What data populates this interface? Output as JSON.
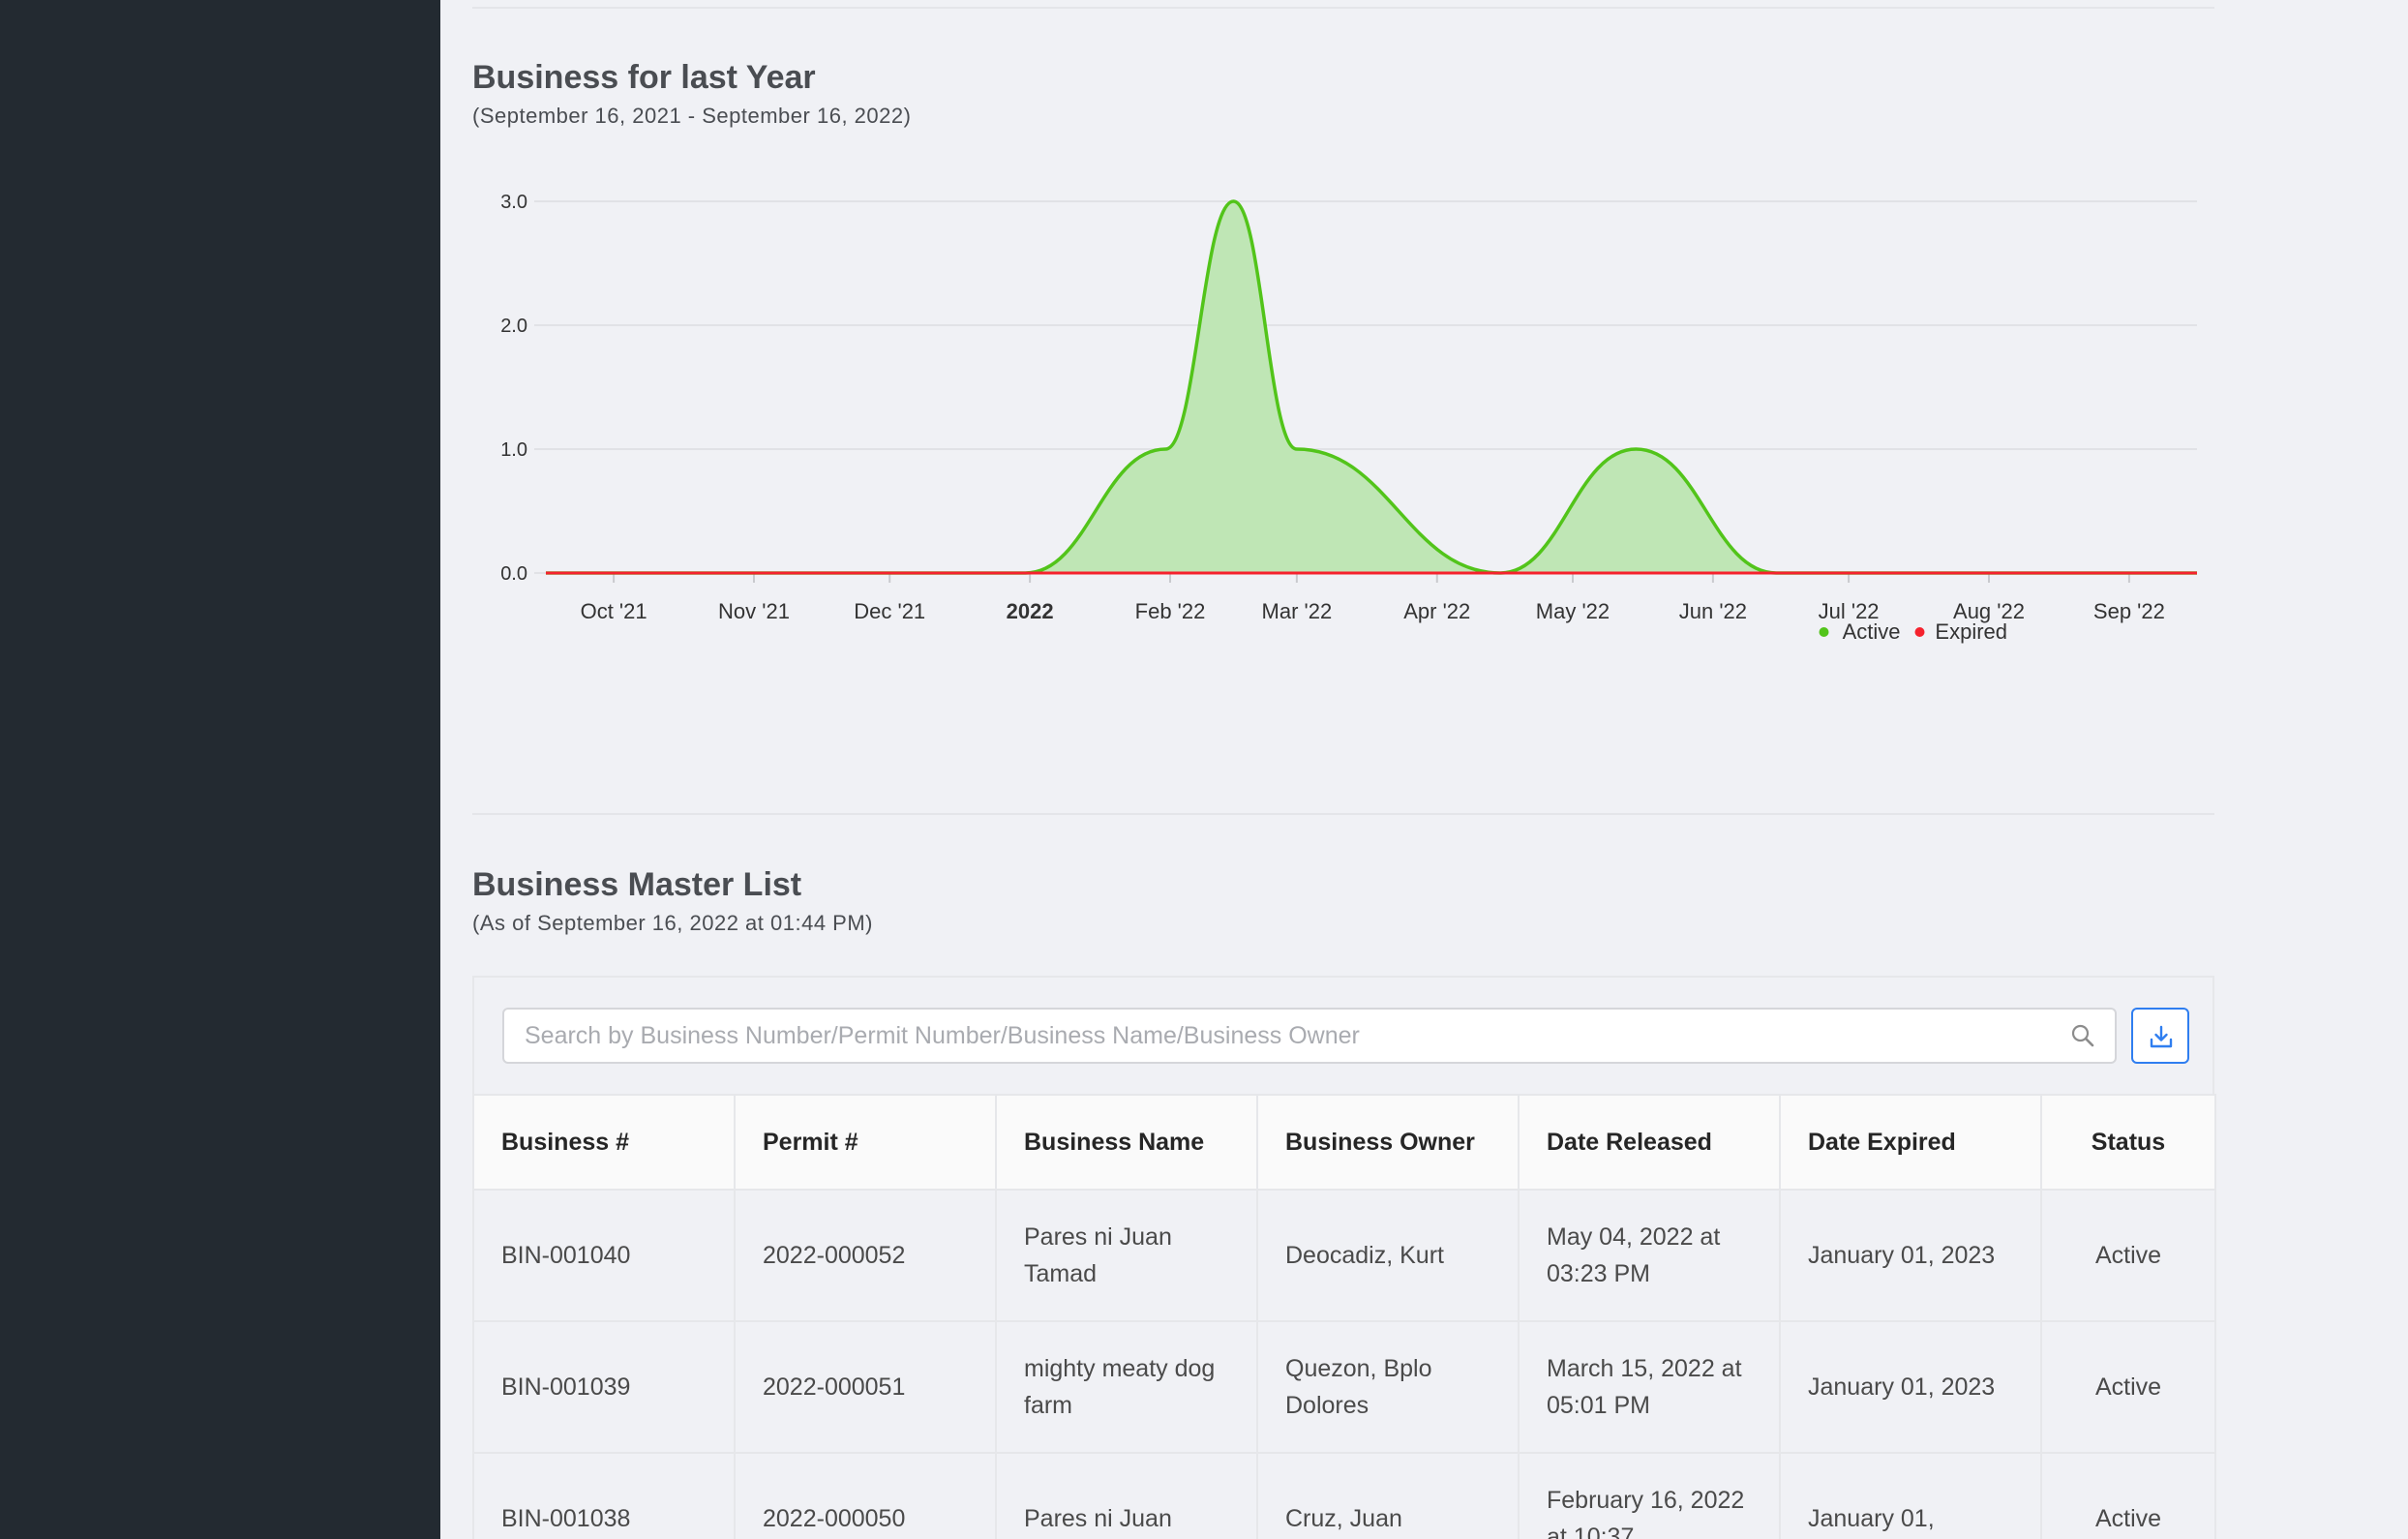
{
  "chart_section": {
    "title": "Business for last Year",
    "subtitle": "(September 16, 2021 - September 16, 2022)"
  },
  "chart_data": {
    "type": "area",
    "x_tick_labels": [
      "Oct '21",
      "Nov '21",
      "Dec '21",
      "2022",
      "Feb '22",
      "Mar '22",
      "Apr '22",
      "May '22",
      "Jun '22",
      "Jul '22",
      "Aug '22",
      "Sep '22"
    ],
    "y_tick_labels": [
      "0.0",
      "1.0",
      "2.0",
      "3.0"
    ],
    "ylim": [
      0,
      3
    ],
    "x_range": [
      "2021-09-16",
      "2022-09-16"
    ],
    "series": [
      {
        "name": "Active",
        "color": "#52c41a",
        "points": [
          {
            "x": "2021-09-16",
            "y": 0
          },
          {
            "x": "2021-12-31",
            "y": 0
          },
          {
            "x": "2022-01-31",
            "y": 1
          },
          {
            "x": "2022-02-15",
            "y": 3
          },
          {
            "x": "2022-03-01",
            "y": 1
          },
          {
            "x": "2022-04-15",
            "y": 0
          },
          {
            "x": "2022-05-15",
            "y": 1
          },
          {
            "x": "2022-06-15",
            "y": 0
          },
          {
            "x": "2022-09-16",
            "y": 0
          }
        ]
      },
      {
        "name": "Expired",
        "color": "#f5222d",
        "points": [
          {
            "x": "2021-09-16",
            "y": 0
          },
          {
            "x": "2022-09-16",
            "y": 0
          }
        ]
      }
    ],
    "legend": "bottom-right",
    "grid": true
  },
  "masterlist": {
    "title": "Business Master List",
    "subtitle": "(As of September 16, 2022 at 01:44 PM)",
    "search_placeholder": "Search by Business Number/Permit Number/Business Name/Business Owner",
    "search_icon": "search-icon",
    "download_icon": "download-icon",
    "columns": [
      "Business #",
      "Permit #",
      "Business Name",
      "Business Owner",
      "Date Released",
      "Date Expired",
      "Status"
    ],
    "rows": [
      [
        "BIN-001040",
        "2022-000052",
        "Pares ni Juan Tamad",
        "Deocadiz, Kurt",
        "May 04, 2022 at 03:23 PM",
        "January 01, 2023",
        "Active"
      ],
      [
        "BIN-001039",
        "2022-000051",
        "mighty meaty dog farm",
        "Quezon, Bplo Dolores",
        "March 15, 2022 at 05:01 PM",
        "January 01, 2023",
        "Active"
      ],
      [
        "BIN-001038",
        "2022-000050",
        "Pares ni Juan",
        "Cruz, Juan",
        "February 16, 2022 at 10:37",
        "January 01,",
        "Active"
      ]
    ]
  }
}
